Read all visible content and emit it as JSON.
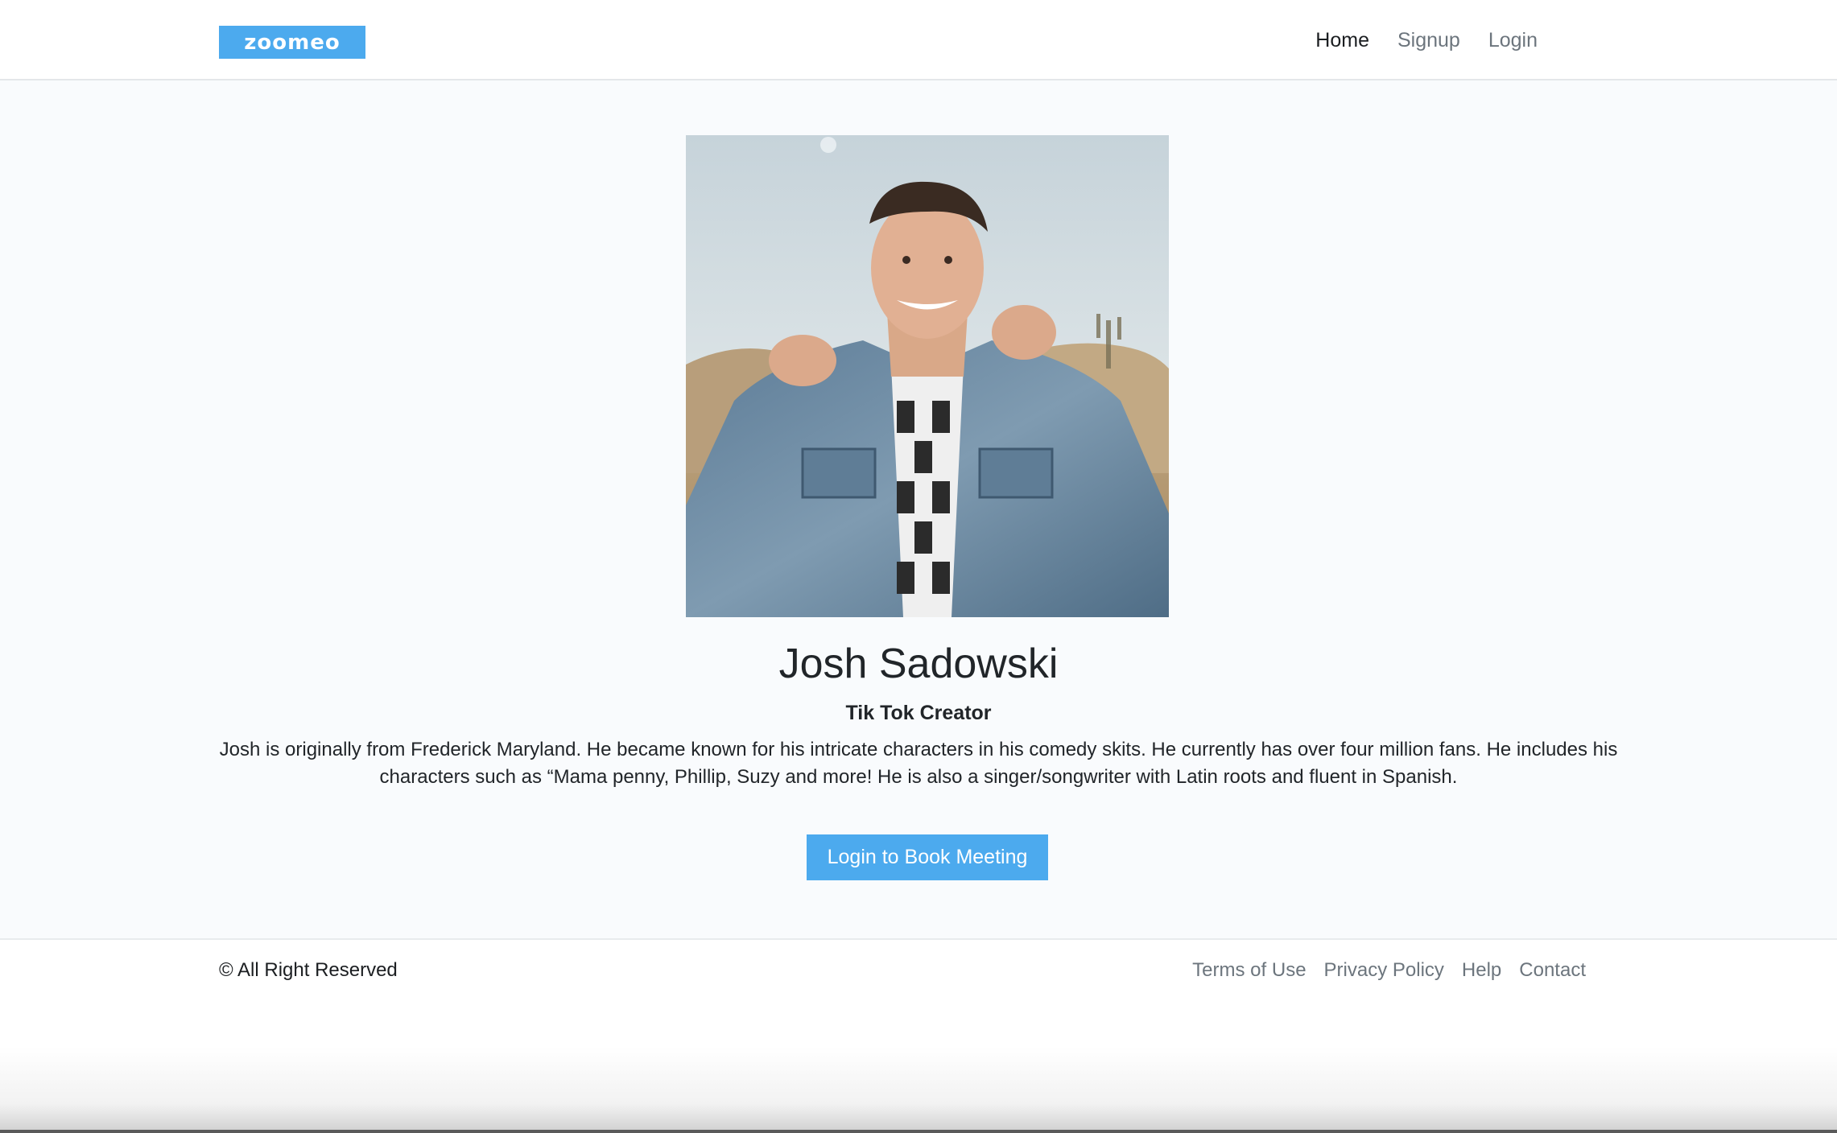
{
  "brand": {
    "logo_text": "zoomeo",
    "accent_color": "#4caaee"
  },
  "nav": {
    "items": [
      {
        "label": "Home",
        "active": true
      },
      {
        "label": "Signup",
        "active": false
      },
      {
        "label": "Login",
        "active": false
      }
    ]
  },
  "profile": {
    "photo_icon": "profile-photo",
    "name": "Josh Sadowski",
    "role": "Tik Tok Creator",
    "bio": "Josh is originally from Frederick Maryland. He became known for his intricate characters in his comedy skits. He currently has over four million fans. He includes his characters such as “Mama penny, Phillip, Suzy and more! He is also a singer/songwriter with Latin roots and fluent in Spanish.",
    "cta_label": "Login to Book Meeting"
  },
  "footer": {
    "copyright": "© All Right Reserved",
    "links": [
      "Terms of Use",
      "Privacy Policy",
      "Help",
      "Contact"
    ]
  }
}
